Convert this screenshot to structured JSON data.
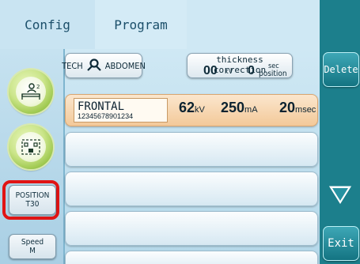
{
  "tabs": [
    {
      "label": "Config"
    },
    {
      "label": "Program"
    }
  ],
  "left_panel": {
    "position_button": {
      "line1": "POSITION",
      "line2": "T30"
    },
    "speed_button": {
      "line1": "Speed",
      "line2": "M"
    }
  },
  "tech_button": {
    "label": "TECH",
    "region": "ABDOMEN"
  },
  "thickness": {
    "title": "thickness correction",
    "value1": "00",
    "unit1": "kV",
    "value2": "0",
    "unit2_line1": "sec",
    "unit2_line2": "position"
  },
  "program_rows": [
    {
      "name": "FRONTAL",
      "id": "12345678901234",
      "kv": "62",
      "kv_unit": "kV",
      "ma": "250",
      "ma_unit": "mA",
      "time": "20",
      "time_unit": "msec"
    }
  ],
  "right_panel": {
    "delete_label": "Delete",
    "exit_label": "Exit"
  },
  "colors": {
    "accent": "#1c7f8c",
    "selected_row": "#f3c999",
    "highlight": "#e11414"
  }
}
